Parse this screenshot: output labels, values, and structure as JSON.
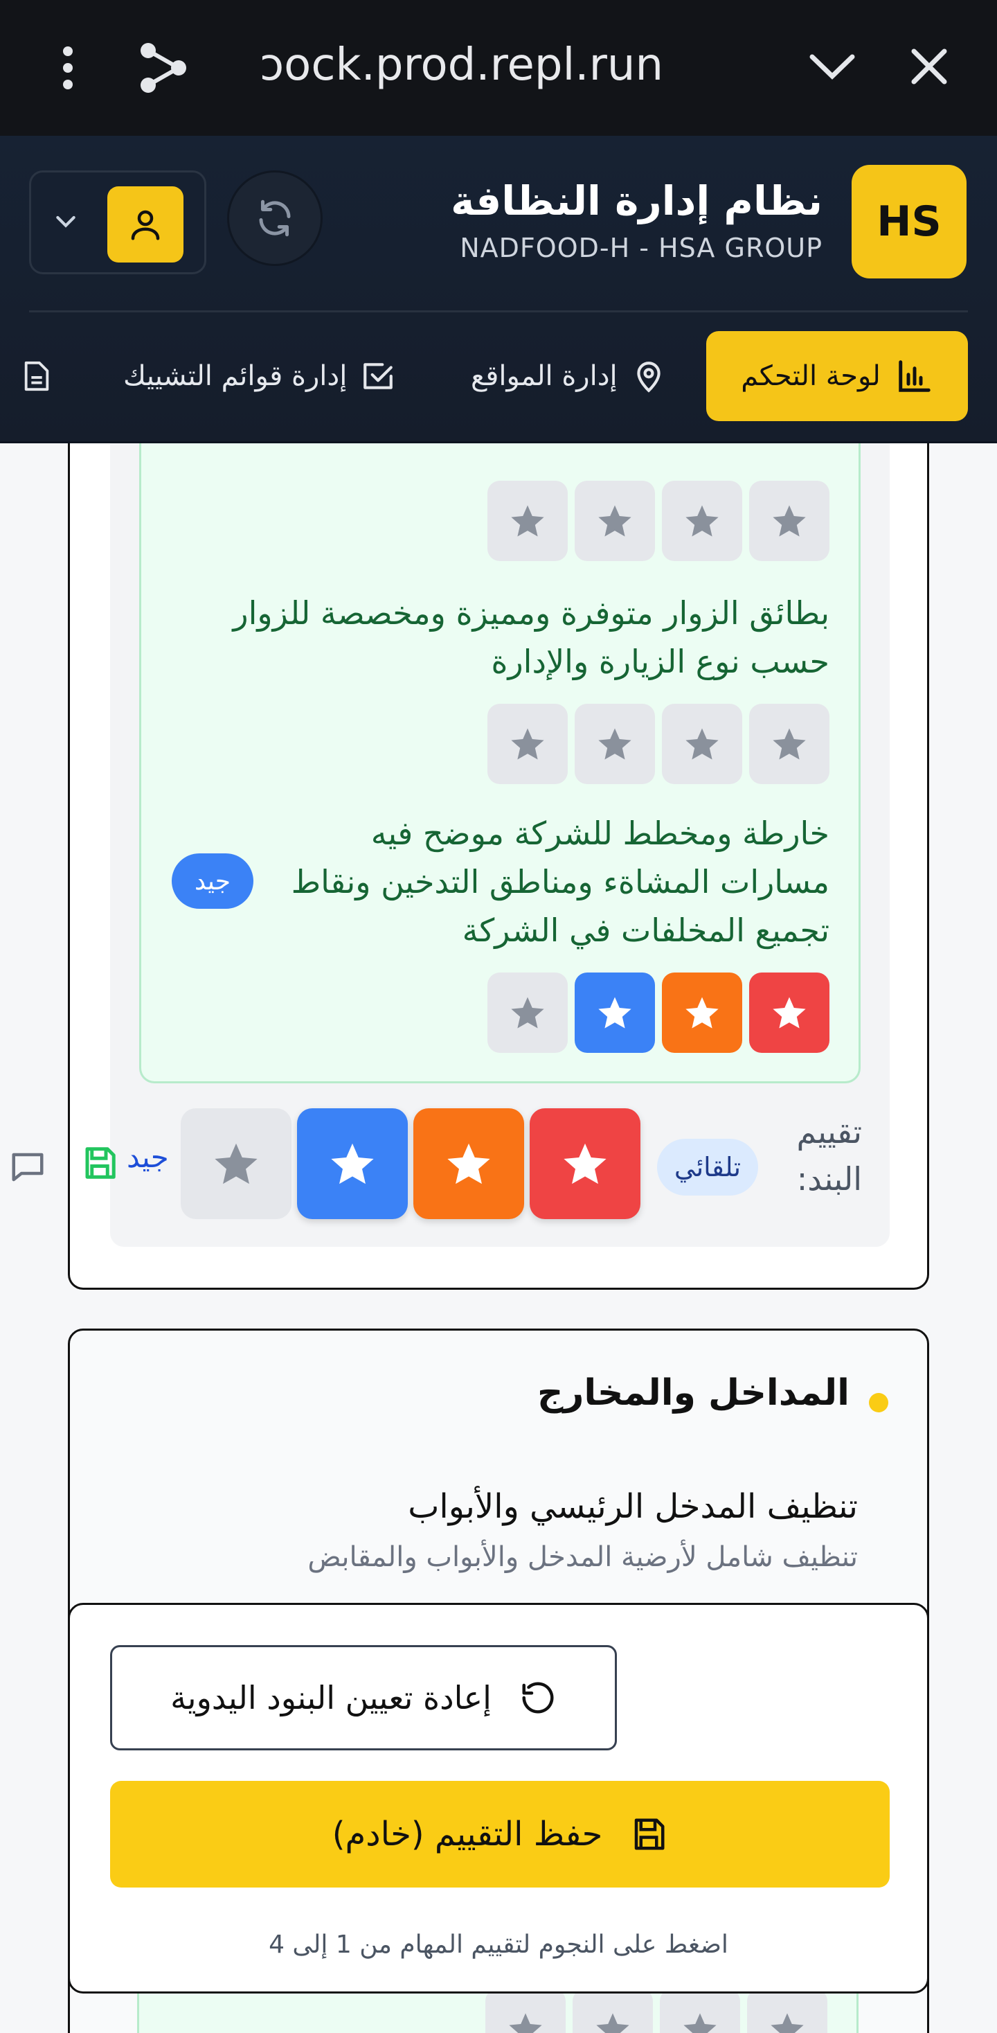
{
  "browser": {
    "url": "ɔock.prod.repl.run"
  },
  "app": {
    "logo_text": "HS",
    "title": "نظام إدارة النظافة",
    "subtitle": "NADFOOD-H - HSA GROUP"
  },
  "nav": {
    "items": [
      {
        "label": "لوحة التحكم",
        "icon": "bar-chart-icon",
        "active": true
      },
      {
        "label": "إدارة المواقع",
        "icon": "map-pin-icon"
      },
      {
        "label": "إدارة قوائم التشييك",
        "icon": "checkbox-icon"
      }
    ]
  },
  "questions": [
    {
      "text": "بطائق الزوار متوفرة ومميزة ومخصصة للزوار حسب نوع الزيارة والإدارة",
      "rating": 0
    },
    {
      "text": "خارطة ومخطط للشركة موضح فيه مسارات المشاةء ومناطق التدخين ونقاط تجميع المخلفات في الشركة",
      "rating": 3,
      "badge": "جيد"
    }
  ],
  "item_rating": {
    "label": "تقييم البند:",
    "mode": "تلقائي",
    "value": 3,
    "max": 4,
    "status": "جيد"
  },
  "section": {
    "title": "المداخل والمخارج",
    "task_title": "تنظيف المدخل الرئيسي والأبواب",
    "task_desc": "تنظيف شامل لأرضية المدخل والأبواب والمقابض"
  },
  "actions": {
    "reset_label": "إعادة تعيين البنود اليدوية",
    "save_label": "حفظ التقييم (خادم)",
    "hint": "اضغط على النجوم لتقييم المهام من 1 إلى 4"
  },
  "colors": {
    "accent": "#facc15",
    "star_1": "#ef4444",
    "star_2": "#f97316",
    "star_3": "#3b82f6",
    "header_bg": "#172233"
  }
}
